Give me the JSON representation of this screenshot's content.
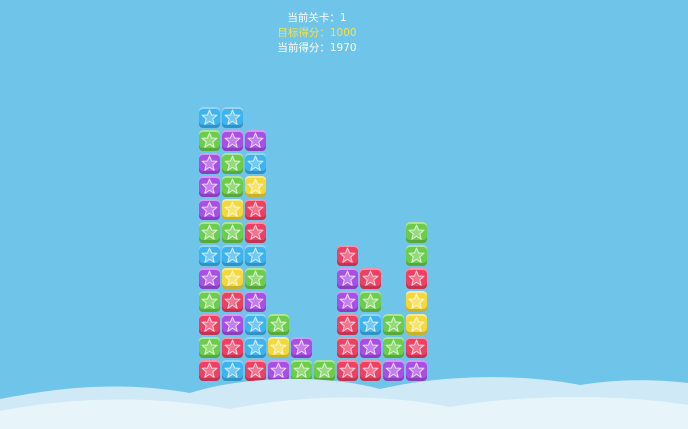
{
  "hud": {
    "level_label": "当前关卡：",
    "level_value": "1",
    "target_label": "目标得分：",
    "target_value": "1000",
    "score_label": "当前得分：",
    "score_value": "1970"
  },
  "colors": {
    "background": "#6ec5e9",
    "blue": "#3fb3ef",
    "purple": "#a94fe6",
    "green": "#6ccd4a",
    "yellow": "#f4d83a",
    "red": "#ef3f63",
    "cloud": "#e7f5fb"
  },
  "tile_icon": "star-icon",
  "board": {
    "columns": [
      [
        "red",
        "green",
        "red",
        "green",
        "purple",
        "blue",
        "green",
        "purple",
        "purple",
        "purple",
        "green",
        "blue"
      ],
      [
        "blue",
        "red",
        "purple",
        "red",
        "yellow",
        "blue",
        "green",
        "yellow",
        "green",
        "green",
        "purple",
        "blue"
      ],
      [
        "red",
        "blue",
        "blue",
        "purple",
        "green",
        "blue",
        "red",
        "red",
        "yellow",
        "blue",
        "purple"
      ],
      [
        "purple",
        "yellow",
        "green"
      ],
      [
        "green",
        "purple"
      ],
      [
        "green"
      ],
      [
        "red",
        "red",
        "red",
        "purple",
        "purple",
        "red"
      ],
      [
        "red",
        "purple",
        "blue",
        "green",
        "red"
      ],
      [
        "purple",
        "green",
        "green"
      ],
      [
        "purple",
        "red",
        "yellow",
        "yellow",
        "red",
        "green",
        "green"
      ]
    ]
  }
}
